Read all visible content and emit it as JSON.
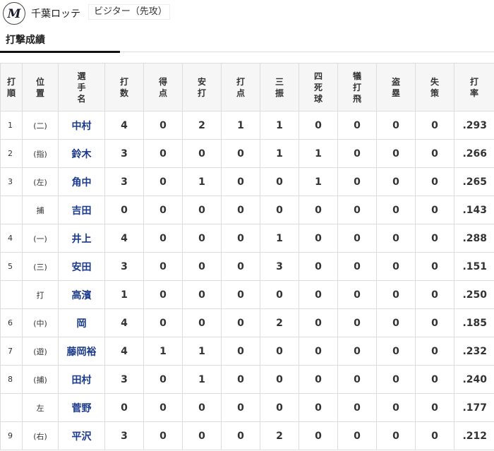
{
  "header": {
    "team_name": "千葉ロッテ",
    "team_role": "ビジター（先攻）"
  },
  "section": {
    "title": "打撃成績"
  },
  "table": {
    "columns": [
      "打順",
      "位置",
      "選手名",
      "打数",
      "得点",
      "安打",
      "打点",
      "三振",
      "四死球",
      "犠打飛",
      "盗塁",
      "失策",
      "打率"
    ],
    "rows": [
      {
        "order": "1",
        "pos": "(二)",
        "name": "中村",
        "stats": [
          "4",
          "0",
          "2",
          "1",
          "1",
          "0",
          "0",
          "0",
          "0"
        ],
        "avg": ".293"
      },
      {
        "order": "2",
        "pos": "(指)",
        "name": "鈴木",
        "stats": [
          "3",
          "0",
          "0",
          "0",
          "1",
          "1",
          "0",
          "0",
          "0"
        ],
        "avg": ".266"
      },
      {
        "order": "3",
        "pos": "(左)",
        "name": "角中",
        "stats": [
          "3",
          "0",
          "1",
          "0",
          "0",
          "1",
          "0",
          "0",
          "0"
        ],
        "avg": ".265"
      },
      {
        "order": "",
        "pos": "捕",
        "name": "吉田",
        "stats": [
          "0",
          "0",
          "0",
          "0",
          "0",
          "0",
          "0",
          "0",
          "0"
        ],
        "avg": ".143"
      },
      {
        "order": "4",
        "pos": "(一)",
        "name": "井上",
        "stats": [
          "4",
          "0",
          "0",
          "0",
          "1",
          "0",
          "0",
          "0",
          "0"
        ],
        "avg": ".288"
      },
      {
        "order": "5",
        "pos": "(三)",
        "name": "安田",
        "stats": [
          "3",
          "0",
          "0",
          "0",
          "3",
          "0",
          "0",
          "0",
          "0"
        ],
        "avg": ".151"
      },
      {
        "order": "",
        "pos": "打",
        "name": "高濱",
        "stats": [
          "1",
          "0",
          "0",
          "0",
          "0",
          "0",
          "0",
          "0",
          "0"
        ],
        "avg": ".250"
      },
      {
        "order": "6",
        "pos": "(中)",
        "name": "岡",
        "stats": [
          "4",
          "0",
          "0",
          "0",
          "2",
          "0",
          "0",
          "0",
          "0"
        ],
        "avg": ".185"
      },
      {
        "order": "7",
        "pos": "(遊)",
        "name": "藤岡裕",
        "stats": [
          "4",
          "1",
          "1",
          "0",
          "0",
          "0",
          "0",
          "0",
          "0"
        ],
        "avg": ".232"
      },
      {
        "order": "8",
        "pos": "(捕)",
        "name": "田村",
        "stats": [
          "3",
          "0",
          "1",
          "0",
          "0",
          "0",
          "0",
          "0",
          "0"
        ],
        "avg": ".240"
      },
      {
        "order": "",
        "pos": "左",
        "name": "菅野",
        "stats": [
          "0",
          "0",
          "0",
          "0",
          "0",
          "0",
          "0",
          "0",
          "0"
        ],
        "avg": ".177"
      },
      {
        "order": "9",
        "pos": "(右)",
        "name": "平沢",
        "stats": [
          "3",
          "0",
          "0",
          "0",
          "2",
          "0",
          "0",
          "0",
          "0"
        ],
        "avg": ".212"
      }
    ]
  },
  "icons": {
    "logo": "marines-m-logo-icon"
  },
  "colors": {
    "player_name": "#1a3a8a",
    "header_bg": "#f6f6f6",
    "border": "#dddddd"
  }
}
